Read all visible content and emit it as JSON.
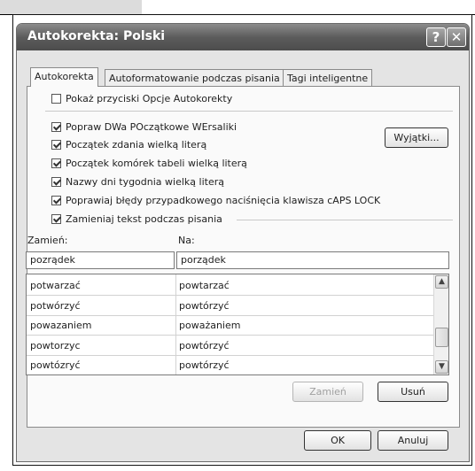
{
  "window": {
    "title": "Autokorekta: Polski",
    "help_glyph": "?",
    "close_glyph": "✕"
  },
  "tabs": [
    {
      "label": "Autokorekta",
      "active": true
    },
    {
      "label": "Autoformatowanie podczas pisania",
      "active": false
    },
    {
      "label": "Tagi inteligentne",
      "active": false
    }
  ],
  "options": {
    "show_buttons": {
      "label": "Pokaż przyciski Opcje Autokorekty",
      "checked": false
    },
    "fix_two_caps": {
      "label": "Popraw DWa POczątkowe WErsaliki",
      "checked": true
    },
    "sentence_caps": {
      "label": "Początek zdania wielką literą",
      "checked": true
    },
    "table_caps": {
      "label": "Początek komórek tabeli wielką literą",
      "checked": true
    },
    "day_names": {
      "label": "Nazwy dni tygodnia wielką literą",
      "checked": true
    },
    "caps_lock": {
      "label": "Poprawiaj błędy przypadkowego naciśnięcia klawisza cAPS LOCK",
      "checked": true
    },
    "replace_text": {
      "label": "Zamieniaj tekst podczas pisania",
      "checked": true
    }
  },
  "exceptions_button": "Wyjątki...",
  "replace": {
    "label_from": "Zamień:",
    "label_to": "Na:",
    "value_from": "pozrądek",
    "value_to": "porządek"
  },
  "entries": [
    {
      "from": "potwarzać",
      "to": "powtarzać"
    },
    {
      "from": "potwórzyć",
      "to": "powtórzyć"
    },
    {
      "from": "powazaniem",
      "to": "poważaniem"
    },
    {
      "from": "powtorzyc",
      "to": "powtórzyć"
    },
    {
      "from": "powtózryć",
      "to": "powtórzyć"
    }
  ],
  "buttons": {
    "replace": "Zamień",
    "delete": "Usuń",
    "ok": "OK",
    "cancel": "Anuluj"
  }
}
